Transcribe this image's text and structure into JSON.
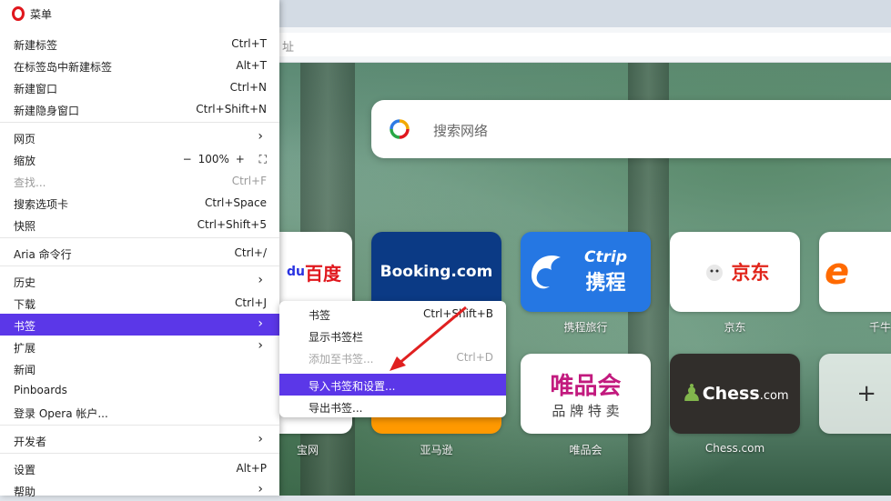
{
  "toolbar": {
    "address_placeholder": "址"
  },
  "search": {
    "placeholder": "搜索网络"
  },
  "tiles": [
    {
      "label": "",
      "logo": "百度"
    },
    {
      "label": "",
      "logo": "Booking.com"
    },
    {
      "label": "携程旅行",
      "logo": "携程",
      "logo_sub": "Ctrip"
    },
    {
      "label": "京东",
      "logo": "京东"
    },
    {
      "label": "千牛",
      "logo": "e"
    },
    {
      "label": "宝网",
      "logo": ""
    },
    {
      "label": "亚马逊",
      "logo": ""
    },
    {
      "label": "唯品会",
      "logo": "唯品会",
      "logo_sub": "品 牌 特 卖"
    },
    {
      "label": "Chess.com",
      "logo": "Chess",
      "logo_sub": ".com"
    },
    {
      "label": "",
      "logo": "+"
    }
  ],
  "menu": {
    "title": "菜单",
    "items": [
      {
        "label": "新建标签",
        "shortcut": "Ctrl+T"
      },
      {
        "label": "在标签岛中新建标签",
        "shortcut": "Alt+T"
      },
      {
        "label": "新建窗口",
        "shortcut": "Ctrl+N"
      },
      {
        "label": "新建隐身窗口",
        "shortcut": "Ctrl+Shift+N"
      },
      {
        "label": "网页",
        "shortcut": ""
      },
      {
        "label": "缩放",
        "shortcut": ""
      },
      {
        "label": "查找...",
        "shortcut": "Ctrl+F"
      },
      {
        "label": "搜索选项卡",
        "shortcut": "Ctrl+Space"
      },
      {
        "label": "快照",
        "shortcut": "Ctrl+Shift+5"
      },
      {
        "label": "Aria 命令行",
        "shortcut": "Ctrl+/"
      },
      {
        "label": "历史",
        "shortcut": ""
      },
      {
        "label": "下载",
        "shortcut": "Ctrl+J"
      },
      {
        "label": "书签",
        "shortcut": ""
      },
      {
        "label": "扩展",
        "shortcut": ""
      },
      {
        "label": "新闻",
        "shortcut": ""
      },
      {
        "label": "Pinboards",
        "shortcut": ""
      },
      {
        "label": "登录 Opera 帐户...",
        "shortcut": ""
      },
      {
        "label": "开发者",
        "shortcut": ""
      },
      {
        "label": "设置",
        "shortcut": "Alt+P"
      },
      {
        "label": "帮助",
        "shortcut": ""
      }
    ],
    "zoom": {
      "minus": "−",
      "value": "100%",
      "plus": "+"
    }
  },
  "bookmarks_submenu": {
    "items": [
      {
        "label": "书签",
        "shortcut": "Ctrl+Shift+B"
      },
      {
        "label": "显示书签栏",
        "shortcut": ""
      },
      {
        "label": "添加至书签...",
        "shortcut": "Ctrl+D"
      },
      {
        "label": "导入书签和设置...",
        "shortcut": ""
      },
      {
        "label": "导出书签...",
        "shortcut": ""
      }
    ]
  },
  "colors": {
    "accent": "#5b37e8",
    "opera_red": "#e0171d",
    "annotation_arrow": "#e02020"
  }
}
